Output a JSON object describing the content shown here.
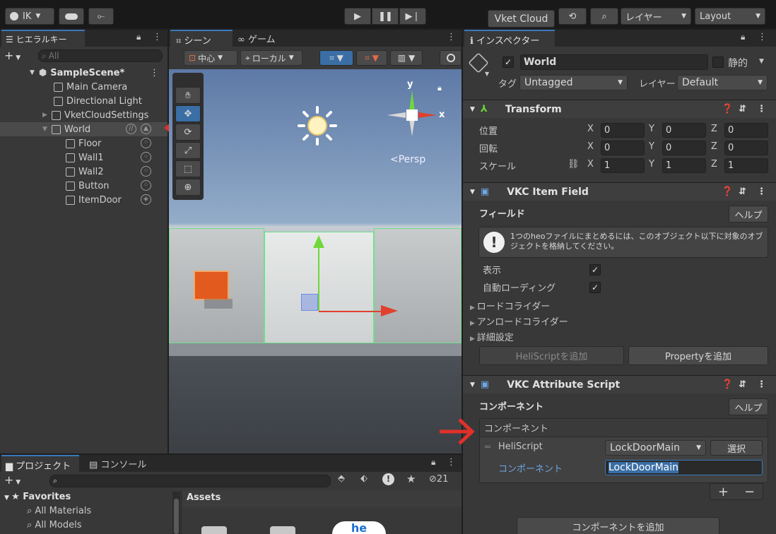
{
  "toolbar": {
    "account": "IK",
    "vket_cloud": "Vket Cloud",
    "layers": "レイヤー",
    "layout": "Layout"
  },
  "hierarchy": {
    "tab": "ヒエラルキー",
    "search_placeholder": "All",
    "scene": "SampleScene*",
    "items": [
      {
        "label": "Main Camera"
      },
      {
        "label": "Directional Light"
      },
      {
        "label": "VketCloudSettings"
      },
      {
        "label": "World"
      },
      {
        "label": "Floor"
      },
      {
        "label": "Wall1"
      },
      {
        "label": "Wall2"
      },
      {
        "label": "Button"
      },
      {
        "label": "ItemDoor"
      }
    ]
  },
  "scene": {
    "tab_scene": "シーン",
    "tab_game": "ゲーム",
    "pivot": "中心",
    "space": "ローカル",
    "persp": "<Persp",
    "axis_y": "y",
    "axis_x": "x"
  },
  "project": {
    "tab_project": "プロジェクト",
    "tab_console": "コンソール",
    "hidden_count": "21",
    "favorites": "Favorites",
    "fav_items": [
      "All Materials",
      "All Models"
    ],
    "assets": "Assets"
  },
  "inspector": {
    "tab": "インスペクター",
    "object_name": "World",
    "static_label": "静的",
    "tag_label": "タグ",
    "tag_value": "Untagged",
    "layer_label": "レイヤー",
    "layer_value": "Default",
    "transform": {
      "title": "Transform",
      "rows": [
        {
          "label": "位置",
          "x": "0",
          "y": "0",
          "z": "0"
        },
        {
          "label": "回転",
          "x": "0",
          "y": "0",
          "z": "0"
        },
        {
          "label": "スケール",
          "x": "1",
          "y": "1",
          "z": "1"
        }
      ]
    },
    "item_field": {
      "title": "VKC Item Field",
      "field_label": "フィールド",
      "help": "ヘルプ",
      "info": "1つのheoファイルにまとめるには、このオブジェクト以下に対象のオブジェクトを格納してください。",
      "show": "表示",
      "auto_loading": "自動ローディング",
      "load_collider": "ロードコライダー",
      "unload_collider": "アンロードコライダー",
      "details": "詳細設定",
      "add_heliscript": "HeliScriptを追加",
      "add_property": "Propertyを追加"
    },
    "attr_script": {
      "title": "VKC Attribute Script",
      "component_label": "コンポーネント",
      "help": "ヘルプ",
      "list_header": "コンポーネント",
      "heliscript_label": "HeliScript",
      "heliscript_value": "LockDoorMain",
      "select": "選択",
      "component_value_label": "コンポーネント",
      "component_value": "LockDoorMain",
      "plus": "+",
      "minus": "−"
    },
    "add_component": "コンポーネントを追加"
  },
  "colors": {
    "accent": "#3a79bb",
    "arrow": "#e0302a"
  }
}
